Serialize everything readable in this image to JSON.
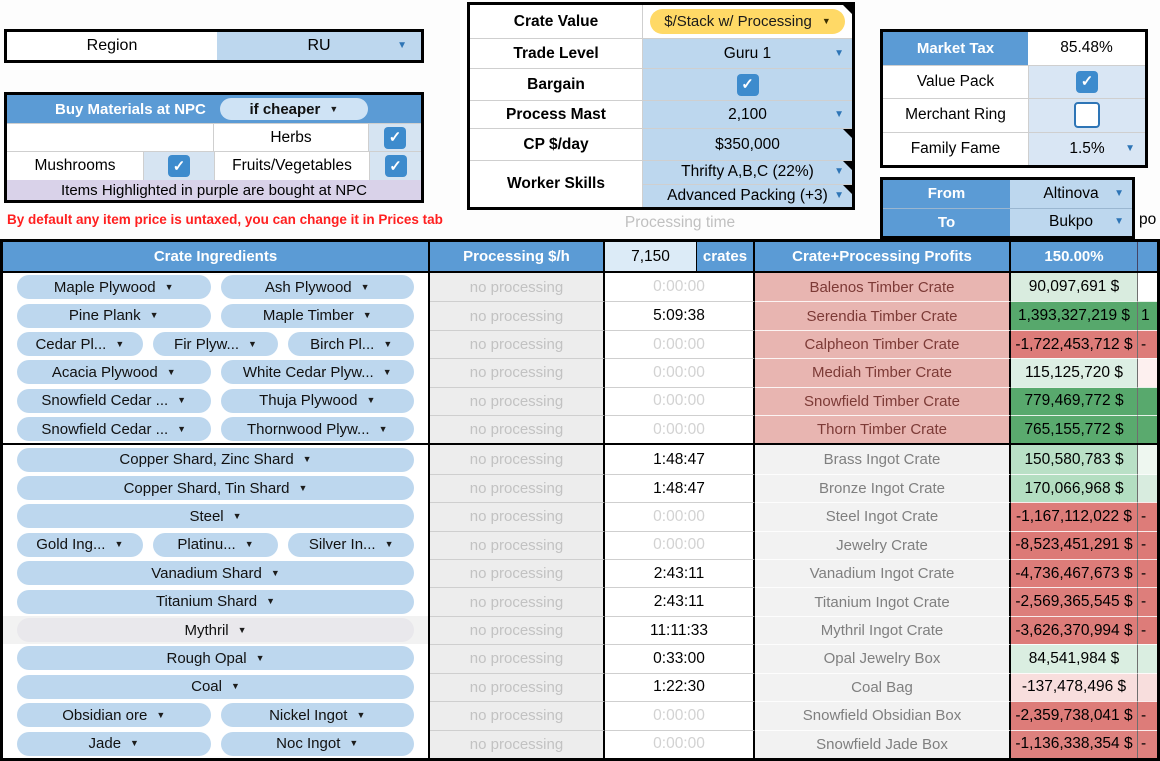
{
  "region": {
    "label": "Region",
    "value": "RU"
  },
  "buy_npc": {
    "title": "Buy Materials at NPC",
    "mode": "if cheaper",
    "herbs_label": "Herbs",
    "herbs_checked": true,
    "mushrooms_label": "Mushrooms",
    "mushrooms_checked": true,
    "fruits_label": "Fruits/Vegetables",
    "fruits_checked": true,
    "note": "Items Highlighted in purple are bought at NPC"
  },
  "warning": "By default any item price is untaxed, you can change it in Prices tab",
  "processing_time_label": "Processing time",
  "settings": {
    "crate_value_label": "Crate Value",
    "crate_value": "$/Stack w/ Processing",
    "trade_level_label": "Trade Level",
    "trade_level": "Guru 1",
    "bargain_label": "Bargain",
    "bargain_checked": true,
    "process_mast_label": "Process Mast",
    "process_mast": "2,100",
    "cp_day_label": "CP $/day",
    "cp_day": "$350,000",
    "worker_skills_label": "Worker Skills",
    "worker_skill_1": "Thrifty A,B,C (22%)",
    "worker_skill_2": "Advanced Packing (+3)"
  },
  "market": {
    "tax_label": "Market Tax",
    "tax_value": "85.48%",
    "value_pack_label": "Value Pack",
    "value_pack_checked": true,
    "merchant_ring_label": "Merchant Ring",
    "merchant_ring_checked": false,
    "family_fame_label": "Family Fame",
    "family_fame": "1.5%"
  },
  "route": {
    "from_label": "From",
    "from": "Altinova",
    "to_label": "To",
    "to": "Bukpo",
    "spill_text": "po"
  },
  "table": {
    "headers": {
      "ingredients": "Crate Ingredients",
      "processing": "Processing $/h",
      "crates_count": "7,150",
      "crates_label": "crates",
      "profits": "Crate+Processing Profits",
      "percent": "150.00%"
    },
    "rows": [
      {
        "pills": [
          "Maple Plywood",
          "Ash Plywood"
        ],
        "processing": "no processing",
        "time": "0:00:00",
        "time_active": false,
        "crate": "Balenos Timber Crate",
        "crate_style": "timber",
        "profit": "90,097,691 $",
        "profit_bg": "#d9ecdf",
        "cut": {
          "text": "",
          "bg": "#ffffff"
        }
      },
      {
        "pills": [
          "Pine Plank",
          "Maple Timber"
        ],
        "processing": "no processing",
        "time": "5:09:38",
        "time_active": true,
        "crate": "Serendia Timber Crate",
        "crate_style": "timber",
        "profit": "1,393,327,219 $",
        "profit_bg": "#57a86c",
        "cut": {
          "text": "1",
          "bg": "#57a86c"
        }
      },
      {
        "pills": [
          "Cedar Pl...",
          "Fir Plyw...",
          "Birch Pl..."
        ],
        "processing": "no processing",
        "time": "0:00:00",
        "time_active": false,
        "crate": "Calpheon Timber Crate",
        "crate_style": "timber",
        "profit": "-1,722,453,712 $",
        "profit_bg": "#dd7c79",
        "cut": {
          "text": "-",
          "bg": "#dd7c79"
        }
      },
      {
        "pills": [
          "Acacia Plywood",
          "White Cedar Plyw..."
        ],
        "processing": "no processing",
        "time": "0:00:00",
        "time_active": false,
        "crate": "Mediah Timber Crate",
        "crate_style": "timber",
        "profit": "115,125,720 $",
        "profit_bg": "#ddefe4",
        "cut": {
          "text": "",
          "bg": "#fdf0ef"
        }
      },
      {
        "pills": [
          "Snowfield Cedar ...",
          "Thuja Plywood"
        ],
        "processing": "no processing",
        "time": "0:00:00",
        "time_active": false,
        "crate": "Snowfield Timber Crate",
        "crate_style": "timber",
        "profit": "779,469,772 $",
        "profit_bg": "#58a96d",
        "cut": {
          "text": "",
          "bg": "#58a96d"
        }
      },
      {
        "pills": [
          "Snowfield Cedar ...",
          "Thornwood Plyw..."
        ],
        "processing": "no processing",
        "time": "0:00:00",
        "time_active": false,
        "crate": "Thorn Timber Crate",
        "crate_style": "timber",
        "profit": "765,155,772 $",
        "profit_bg": "#5aaa6e",
        "cut": {
          "text": "",
          "bg": "#5aaa6e"
        }
      },
      {
        "pills": [
          "Copper Shard, Zinc Shard"
        ],
        "processing": "no processing",
        "time": "1:48:47",
        "time_active": true,
        "crate": "Brass Ingot Crate",
        "crate_style": "grey",
        "profit": "150,580,783 $",
        "profit_bg": "#b9e0c6",
        "thick_top": true,
        "cut": {
          "text": "",
          "bg": "#eef7f0"
        }
      },
      {
        "pills": [
          "Copper Shard, Tin Shard"
        ],
        "processing": "no processing",
        "time": "1:48:47",
        "time_active": true,
        "crate": "Bronze Ingot Crate",
        "crate_style": "grey",
        "profit": "170,066,968 $",
        "profit_bg": "#b3dec1",
        "cut": {
          "text": "",
          "bg": "#d8ecdf"
        }
      },
      {
        "pills": [
          "Steel"
        ],
        "processing": "no processing",
        "time": "0:00:00",
        "time_active": false,
        "crate": "Steel Ingot Crate",
        "crate_style": "grey",
        "profit": "-1,167,112,022 $",
        "profit_bg": "#dd7c79",
        "cut": {
          "text": "-",
          "bg": "#dd7c79"
        }
      },
      {
        "pills": [
          "Gold Ing...",
          "Platinu...",
          "Silver In..."
        ],
        "processing": "no processing",
        "time": "0:00:00",
        "time_active": false,
        "crate": "Jewelry Crate",
        "crate_style": "grey",
        "profit": "-8,523,451,291 $",
        "profit_bg": "#dc7976",
        "cut": {
          "text": "-",
          "bg": "#dc7976"
        }
      },
      {
        "pills": [
          "Vanadium Shard"
        ],
        "processing": "no processing",
        "time": "2:43:11",
        "time_active": true,
        "crate": "Vanadium Ingot Crate",
        "crate_style": "grey",
        "profit": "-4,736,467,673 $",
        "profit_bg": "#dd7c79",
        "cut": {
          "text": "-",
          "bg": "#dd7c79"
        }
      },
      {
        "pills": [
          "Titanium Shard"
        ],
        "processing": "no processing",
        "time": "2:43:11",
        "time_active": true,
        "crate": "Titanium Ingot Crate",
        "crate_style": "grey",
        "profit": "-2,569,365,545 $",
        "profit_bg": "#dd7e7b",
        "cut": {
          "text": "-",
          "bg": "#dd7e7b"
        }
      },
      {
        "pills": [
          "Mythril"
        ],
        "pill_grey": true,
        "grey_row": true,
        "processing": "no processing",
        "time": "11:11:33",
        "time_active": true,
        "crate": "Mythril Ingot Crate",
        "crate_style": "grey",
        "profit": "-3,626,370,994 $",
        "profit_bg": "#dd7c79",
        "cut": {
          "text": "-",
          "bg": "#dd7c79"
        }
      },
      {
        "pills": [
          "Rough Opal"
        ],
        "processing": "no processing",
        "time": "0:33:00",
        "time_active": true,
        "crate": "Opal Jewelry Box",
        "crate_style": "grey",
        "profit": "84,541,984 $",
        "profit_bg": "#daeee1",
        "cut": {
          "text": "",
          "bg": "#daeee1"
        }
      },
      {
        "pills": [
          "Coal"
        ],
        "processing": "no processing",
        "time": "1:22:30",
        "time_active": true,
        "crate": "Coal Bag",
        "crate_style": "grey",
        "profit": "-137,478,496 $",
        "profit_bg": "#f8dedd",
        "cut": {
          "text": "",
          "bg": "#f8dedd"
        }
      },
      {
        "pills": [
          "Obsidian ore",
          "Nickel Ingot"
        ],
        "processing": "no processing",
        "time": "0:00:00",
        "time_active": false,
        "crate": "Snowfield Obsidian Box",
        "crate_style": "grey",
        "profit": "-2,359,738,041 $",
        "profit_bg": "#dd7c79",
        "cut": {
          "text": "-",
          "bg": "#dd7c79"
        }
      },
      {
        "pills": [
          "Jade",
          "Noc Ingot"
        ],
        "processing": "no processing",
        "time": "0:00:00",
        "time_active": false,
        "crate": "Snowfield Jade Box",
        "crate_style": "grey",
        "profit": "-1,136,338,354 $",
        "profit_bg": "#de817e",
        "cut": {
          "text": "-",
          "bg": "#de817e"
        }
      }
    ]
  },
  "colors": {
    "header_blue": "#5b9bd5",
    "light_blue": "#bdd7ee",
    "lighter_blue": "#dcebf7",
    "checkbox_blue": "#3d8bcd",
    "purple": "#d9d2e9",
    "timber_bg": "#e8b5b1",
    "timber_text": "#7c3a36",
    "gold": "#ffd966",
    "warning_red": "#ff1f1f"
  }
}
